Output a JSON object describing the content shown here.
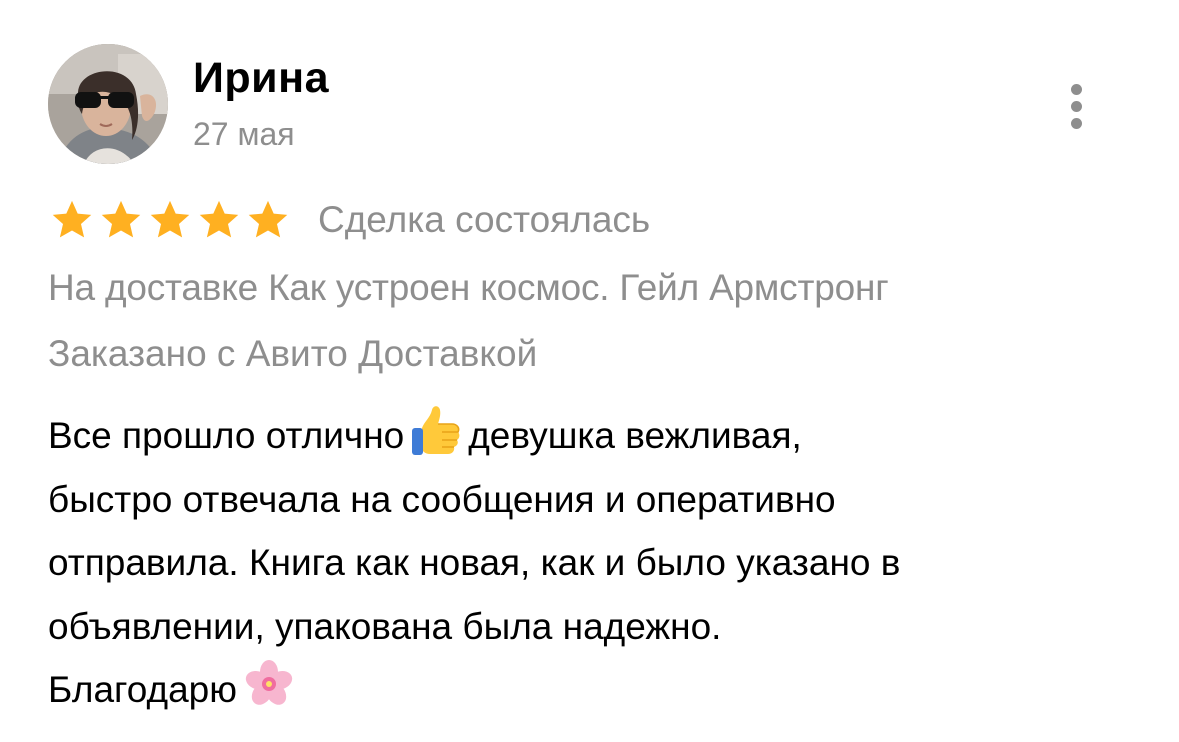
{
  "review": {
    "author": {
      "name": "Ирина",
      "avatar_icon": "user-photo-avatar"
    },
    "date": "27 мая",
    "menu_icon": "more-vertical-icon",
    "rating": {
      "stars": 5,
      "max": 5,
      "star_color": "#FFB021"
    },
    "deal_status": "Сделка состоялась",
    "item_line": "На доставке Как устроен космос. Гейл Армстронг",
    "delivery_line": "Заказано с Авито Доставкой",
    "text": {
      "line1_a": "Все прошло отлично",
      "line1_emoji": "thumbs-up-emoji",
      "line1_b": "девушка вежливая,",
      "line2": "быстро отвечала на сообщения и оперативно",
      "line3": "отправила. Книга как новая, как и было указано в",
      "line4": "объявлении, упакована была надежно.",
      "line5_a": "Благодарю",
      "line5_emoji": "cherry-blossom-emoji"
    }
  },
  "colors": {
    "secondary_text": "#8E8E8E",
    "primary_text": "#000000",
    "background": "#FFFFFF"
  }
}
